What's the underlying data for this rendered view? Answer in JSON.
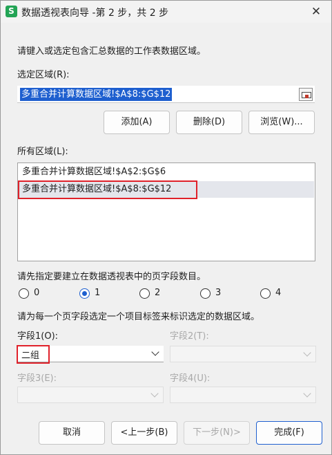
{
  "window": {
    "app_icon": "S",
    "title": "数据透视表向导 -第 2 步，共 2 步",
    "close": "✕"
  },
  "instructions": {
    "step1": "请键入或选定包含汇总数据的工作表数据区域。",
    "step2": "请先指定要建立在数据透视表中的页字段数目。",
    "step3": "请为每一个页字段选定一个项目标签来标识选定的数据区域。"
  },
  "selected_region": {
    "label": "选定区域(R):",
    "value": "多重合并计算数据区域!$A$8:$G$12"
  },
  "region_buttons": {
    "add": "添加(A)",
    "delete": "删除(D)",
    "browse": "浏览(W)..."
  },
  "all_regions": {
    "label": "所有区域(L):",
    "items": [
      "多重合并计算数据区域!$A$2:$G$6",
      "多重合并计算数据区域!$A$8:$G$12"
    ]
  },
  "page_fields": {
    "options": [
      "0",
      "1",
      "2",
      "3",
      "4"
    ],
    "selected": "1"
  },
  "fields": {
    "field1_label": "字段1(O):",
    "field1_value": "二组",
    "field2_label": "字段2(T):",
    "field3_label": "字段3(E):",
    "field4_label": "字段4(U):"
  },
  "footer": {
    "cancel": "取消",
    "prev": "<上一步(B)",
    "next": "下一步(N)>",
    "finish": "完成(F)"
  },
  "colors": {
    "accent": "#1e5fcf",
    "highlight_border": "#e0212a",
    "selection": "#1e5fcf"
  }
}
